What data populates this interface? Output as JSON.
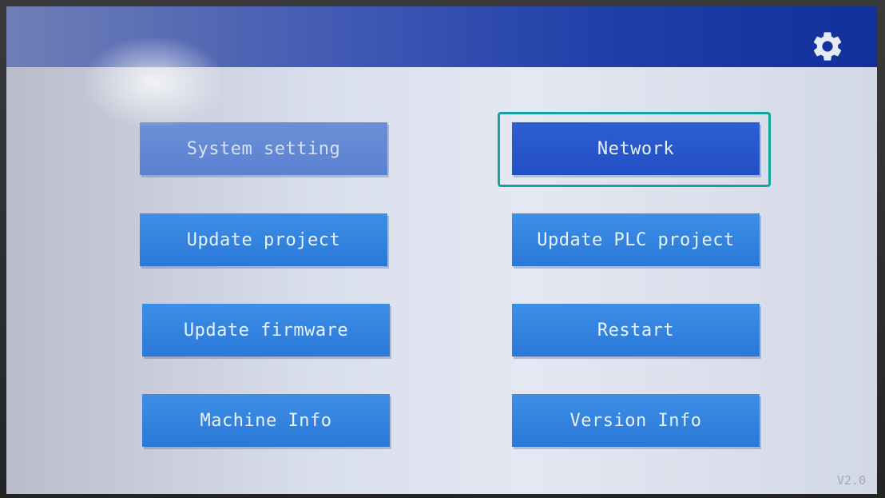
{
  "header": {
    "settings_icon": "gear-icon"
  },
  "menu": {
    "system_setting": "System setting",
    "network": "Network",
    "update_project": "Update project",
    "update_plc_project": "Update PLC project",
    "update_firmware": "Update firmware",
    "restart": "Restart",
    "machine_info": "Machine Info",
    "version_info": "Version Info"
  },
  "footer": {
    "version": "V2.0"
  },
  "colors": {
    "button": "#2a78d8",
    "button_selected": "#234fc4",
    "highlight": "#15a39b",
    "header": "#1f3ea8"
  }
}
